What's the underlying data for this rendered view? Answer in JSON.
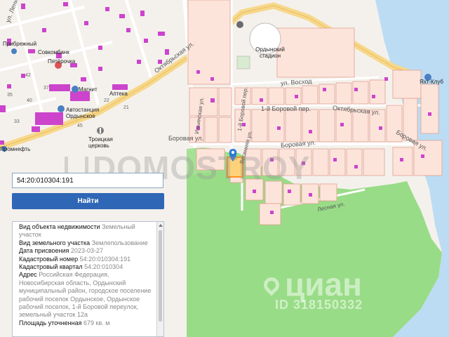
{
  "map": {
    "streets": {
      "lenina": "ул. Ленина",
      "oktyabrskaya": "Октябрьская ул.",
      "oktyabrskaya2": "Октябрьская ул.",
      "voskhod": "ул. Восход",
      "borovoy_per_1": "1-й Боровой пер.",
      "borovaya": "Боровая ул.",
      "borovaya2": "Боровая ул.",
      "borovaya3": "Боровая ул.",
      "kosmonavtov": "Весенняя ул.",
      "borovoy_side": "1-й Боровой пер.",
      "ilyin": "Ильинская ул.",
      "pbk": "Лесная ул."
    },
    "pois": {
      "sovcombank": "Совкомбанк",
      "pyaterochka": "Пятёрочка",
      "magnit": "Магнит",
      "avtostanciya": "Автостанция Ордынское",
      "troickaya": "Троицкая церковь",
      "stadion": "Ордынский стадион",
      "apteka": "Аптека",
      "yacht": "Яхт-Клуб",
      "bereg": "Прибрежный",
      "promneft": "Промнефть"
    },
    "numbers": [
      "42",
      "35",
      "40",
      "37",
      "33",
      "22",
      "21",
      "45"
    ],
    "watermark_domostroy": "DOMOSTROY",
    "watermark_cian": "циан",
    "watermark_id": "ID 318150332"
  },
  "search": {
    "value": "54:20:010304:191",
    "button_label": "Найти"
  },
  "info": {
    "rows": [
      {
        "key": "Вид объекта недвижимости",
        "value": "Земельный участок"
      },
      {
        "key": "Вид земельного участка",
        "value": "Землепользование"
      },
      {
        "key": "Дата присвоения",
        "value": "2023-03-27"
      },
      {
        "key": "Кадастровый номер",
        "value": "54:20:010304:191"
      },
      {
        "key": "Кадастровый квартал",
        "value": "54:20:010304"
      },
      {
        "key": "Адрес",
        "value": "Российская Федерация, Новосибирская область, Ордынский муниципальный район, городское поселение рабочий поселок Ордынское, Ордынское рабочий поселок, 1-й Боровой переулок, земельный участок 12а"
      },
      {
        "key": "Площадь уточненная",
        "value": "679 кв. м"
      }
    ]
  },
  "colors": {
    "water": "#bcdcf3",
    "forest": "#99dc87",
    "parcel": "#fde4db",
    "parcel_border": "#e0a090",
    "building": "#cc44cc",
    "road": "#f7d88a",
    "button": "#2f66b6",
    "marker": "#2979d8"
  }
}
